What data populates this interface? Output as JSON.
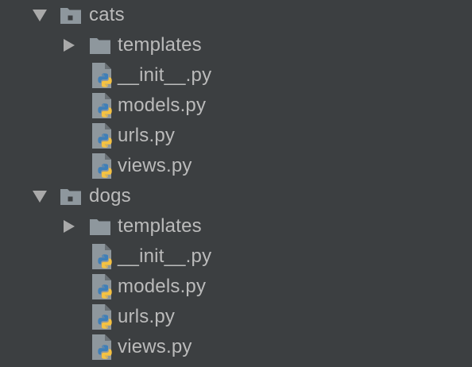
{
  "tree": {
    "cats": {
      "label": "cats",
      "children": {
        "templates": "templates",
        "init": "__init__.py",
        "models": "models.py",
        "urls": "urls.py",
        "views": "views.py"
      }
    },
    "dogs": {
      "label": "dogs",
      "children": {
        "templates": "templates",
        "init": "__init__.py",
        "models": "models.py",
        "urls": "urls.py",
        "views": "views.py"
      }
    }
  },
  "icons": {
    "expanded_arrow": "chevron-down-icon",
    "collapsed_arrow": "chevron-right-icon",
    "package_folder": "package-folder-icon",
    "folder": "folder-icon",
    "python_file": "python-file-icon"
  },
  "colors": {
    "background": "#3c3f41",
    "text": "#bbbbbb",
    "arrow": "#a9a9a9",
    "folder": "#8e979d",
    "python_blue": "#3f7fb8",
    "python_yellow": "#f5c242"
  }
}
